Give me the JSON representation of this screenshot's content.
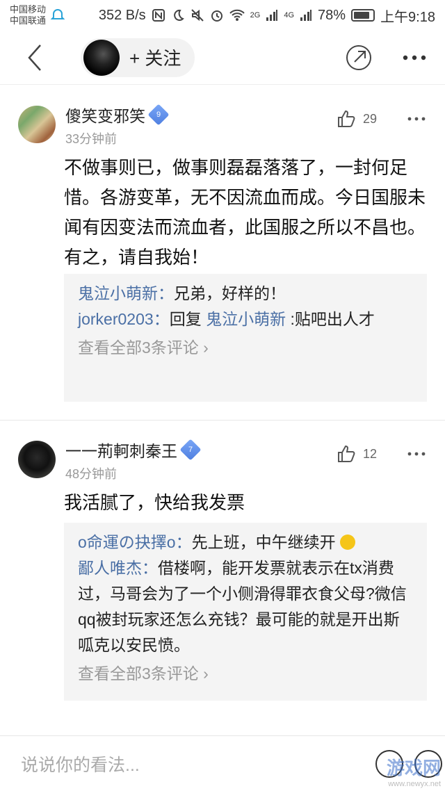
{
  "status_bar": {
    "carrier1": "中国移动",
    "carrier2": "中国联通",
    "speed": "352 B/s",
    "net1": "2G",
    "net2": "4G",
    "battery": "78%",
    "time": "上午9:18"
  },
  "nav": {
    "follow_label": "+ 关注"
  },
  "comments": [
    {
      "username": "傻笑变邪笑",
      "level": "9",
      "time": "33分钟前",
      "likes": "29",
      "body": "不做事则已，做事则磊磊落落了，一封何足惜。各游变革，无不因流血而成。今日国服未闻有因变法而流血者，此国服之所以不昌也。有之，请自我始！",
      "replies": [
        {
          "name": "鬼泣小萌新",
          "text": "兄弟，好样的！"
        },
        {
          "name": "jorker0203",
          "reply_word": "回复",
          "target": "鬼泣小萌新",
          "text": ":贴吧出人才"
        }
      ],
      "view_all": "查看全部3条评论"
    },
    {
      "username": "一一荊軻刺秦王",
      "level": "7",
      "time": "48分钟前",
      "likes": "12",
      "body": "我活腻了，快给我发票",
      "replies": [
        {
          "name": "o命運の抉擇o",
          "text": "先上班，中午继续开"
        },
        {
          "name": "鄙人唯杰",
          "text": "借楼啊，能开发票就表示在tx消费过，马哥会为了一个小侧滑得罪衣食父母?微信qq被封玩家还怎么充钱？最可能的就是开出斯呱克以安民愤。"
        }
      ],
      "view_all": "查看全部3条评论"
    }
  ],
  "input": {
    "placeholder": "说说你的看法..."
  },
  "watermark": {
    "text": "游戏网",
    "url": "www.newyx.net"
  }
}
